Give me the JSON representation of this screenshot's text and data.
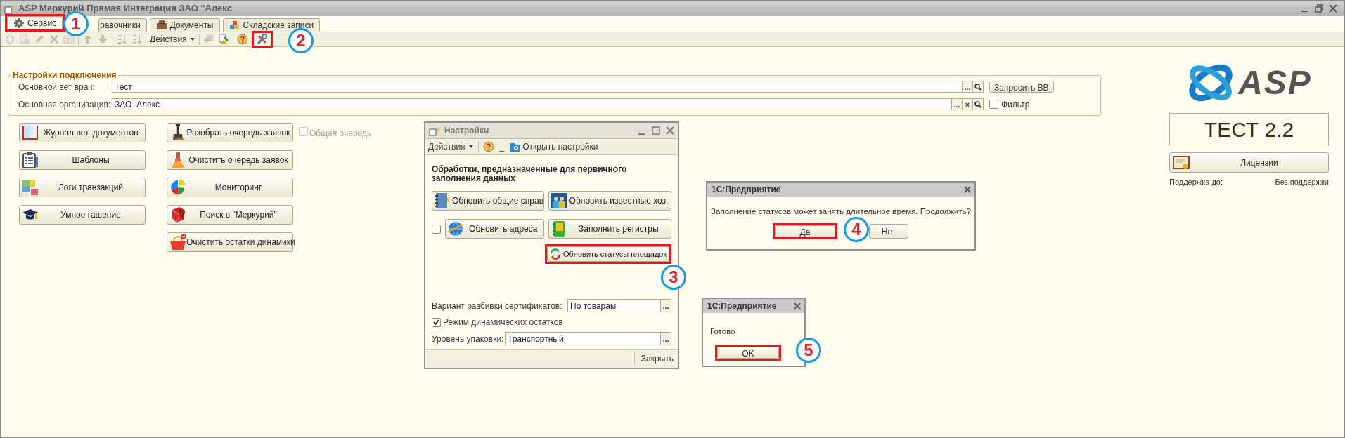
{
  "window": {
    "title": "ASP Меркурий Прямая Интеграция ЗАО \"Алекс"
  },
  "tabs": [
    {
      "label": "Сервис",
      "selected": true,
      "highlighted": true
    },
    {
      "label": "равочники",
      "selected": false,
      "highlighted": false
    },
    {
      "label": "Документы",
      "selected": false,
      "highlighted": false
    },
    {
      "label": "Складские записи",
      "selected": false,
      "highlighted": false
    }
  ],
  "toolbar": [
    {
      "kind": "button",
      "disabled": true,
      "highlighted": false
    },
    {
      "kind": "button",
      "disabled": true,
      "highlighted": false
    },
    {
      "kind": "button",
      "disabled": true,
      "highlighted": false
    },
    {
      "kind": "button",
      "disabled": true,
      "highlighted": false
    },
    {
      "kind": "button",
      "disabled": true,
      "highlighted": false
    },
    {
      "kind": "separator"
    },
    {
      "kind": "button",
      "disabled": true,
      "highlighted": false
    },
    {
      "kind": "button",
      "disabled": true,
      "highlighted": false
    },
    {
      "kind": "separator"
    },
    {
      "kind": "button",
      "disabled": true,
      "highlighted": false
    },
    {
      "kind": "button",
      "disabled": true,
      "highlighted": false
    },
    {
      "kind": "separator"
    },
    {
      "kind": "menu",
      "label": "Действия"
    },
    {
      "kind": "separator"
    },
    {
      "kind": "button",
      "disabled": true,
      "highlighted": false
    },
    {
      "kind": "button",
      "disabled": false,
      "highlighted": false
    },
    {
      "kind": "separator"
    },
    {
      "kind": "button",
      "disabled": false,
      "highlighted": false
    },
    {
      "kind": "button",
      "disabled": false,
      "highlighted": true
    }
  ],
  "connection": {
    "title": "Настройки подключения",
    "fields": [
      {
        "label": "Основной вет врач:",
        "value": "Тест",
        "buttons": [
          {
            "kind": "text",
            "label": "..."
          },
          {
            "kind": "search"
          }
        ]
      },
      {
        "label": "Основная организация:",
        "value": "ЗАО  Алекс",
        "buttons": [
          {
            "kind": "text",
            "label": "..."
          },
          {
            "kind": "text",
            "label": "×"
          },
          {
            "kind": "search"
          }
        ]
      }
    ],
    "request_button": "Запросить ВВ",
    "filter": {
      "label": "Фильтр",
      "checked": false
    }
  },
  "actions": {
    "column_1": [
      "Журнал вет. документов",
      "Шаблоны",
      "Логи транзакций",
      "Умное гашение"
    ],
    "column_2": [
      "Разобрать очередь заявок",
      "Очистить очередь заявок",
      "Мониторинг",
      "Поиск в \"Меркурий\"",
      "Очистить остатки динамики"
    ],
    "shared_queue": {
      "label": "Общая очередь",
      "checked": false,
      "disabled": true
    }
  },
  "info": {
    "logo_text": "ASP",
    "product": "ТЕСТ 2.2",
    "licenses_button": "Лицензии",
    "support_label": "Поддержка до:",
    "support_value": "Без поддержки"
  },
  "settings_dialog": {
    "title": "Настройки",
    "menu": "Действия",
    "underscore": "_",
    "open_settings": "Открыть настройки",
    "heading": "Обработки, предназначенные для первичного заполнения данных",
    "buttons": [
      {
        "label": "Обновить общие справ",
        "highlighted": false
      },
      {
        "label": "Обновить известные хоз.",
        "highlighted": false
      },
      {
        "label": "Обновить адреса",
        "highlighted": false
      },
      {
        "label": "Заполнить регистры",
        "highlighted": false
      },
      {
        "label": "Обновить статусы площадок",
        "highlighted": true
      }
    ],
    "addresses_checkbox": {
      "checked": false
    },
    "split_label": "Вариант разбивки сертификатов:",
    "split_value": "По товарам",
    "dynamic_mode": {
      "label": "Режим динамических остатков",
      "checked": true
    },
    "packaging_label": "Уровень упаковки:",
    "packaging_value": "Транспортный",
    "field_button": "...",
    "close_button": "Закрыть"
  },
  "confirm_dialog": {
    "title": "1С:Предприятие",
    "message": "Заполнение статусов может занять длительное время. Продолжить?",
    "buttons": [
      {
        "label": "Да",
        "highlighted": true
      },
      {
        "label": "Нет",
        "highlighted": false
      }
    ]
  },
  "done_dialog": {
    "title": "1С:Предприятие",
    "message": "Готово",
    "buttons": [
      {
        "label": "OK",
        "highlighted": true
      }
    ]
  },
  "annotations": [
    "1",
    "2",
    "3",
    "4",
    "5"
  ]
}
